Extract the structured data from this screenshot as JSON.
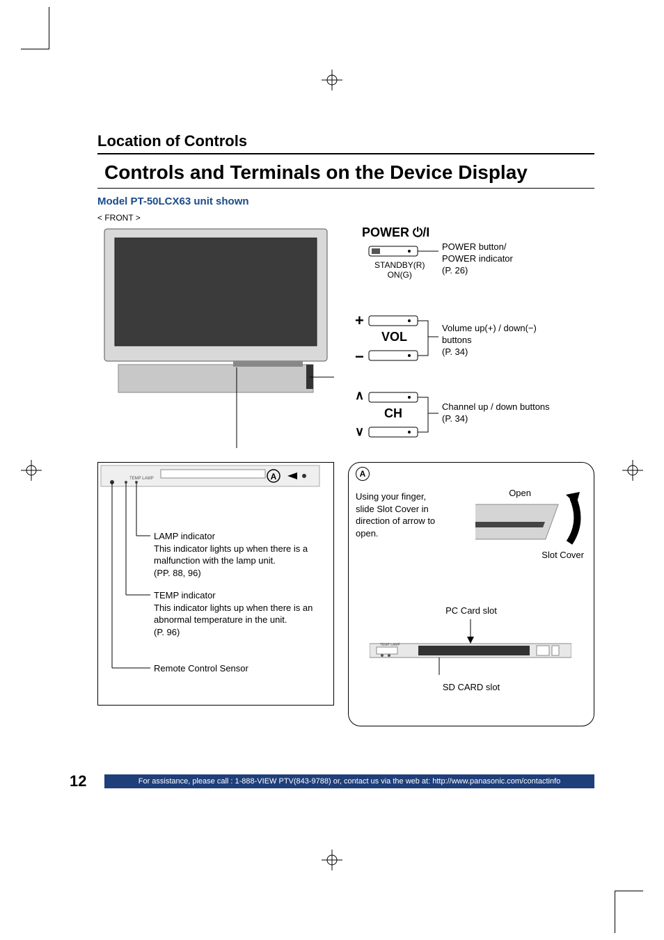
{
  "page_number": "12",
  "footer": "For assistance, please call : 1-888-VIEW PTV(843-9788) or, contact us via the web at: http://www.panasonic.com/contactinfo",
  "section_heading": "Location of Controls",
  "title": "Controls and Terminals on the Device Display",
  "subtitle": "Model PT-50LCX63 unit shown",
  "front_label": "< FRONT >",
  "controls": {
    "power_heading": "POWER",
    "power_label": "POWER button/\nPOWER indicator\n(P. 26)",
    "standby_r": "STANDBY(R)",
    "on_g": "ON(G)",
    "vol_heading": "VOL",
    "vol_label": "Volume up(+) / down(−) buttons\n(P. 34)",
    "ch_heading": "CH",
    "ch_label": "Channel up / down buttons\n(P. 34)"
  },
  "indicators": {
    "lamp_title": "LAMP indicator",
    "lamp_body": "This indicator lights up when there is a malfunction with the lamp unit.\n(PP. 88, 96)",
    "temp_title": "TEMP indicator",
    "temp_body": "This indicator lights up when there is an abnormal temperature in the unit.\n(P. 96)",
    "remote_sensor": "Remote Control Sensor"
  },
  "slot": {
    "marker": "A",
    "instruction": "Using your finger, slide Slot Cover in direction of arrow to open.",
    "open_label": "Open",
    "slot_cover": "Slot Cover",
    "pc_card": "PC Card slot",
    "sd_card": "SD CARD slot",
    "panel_temp": "TEMP",
    "panel_lamp": "LAMP"
  }
}
